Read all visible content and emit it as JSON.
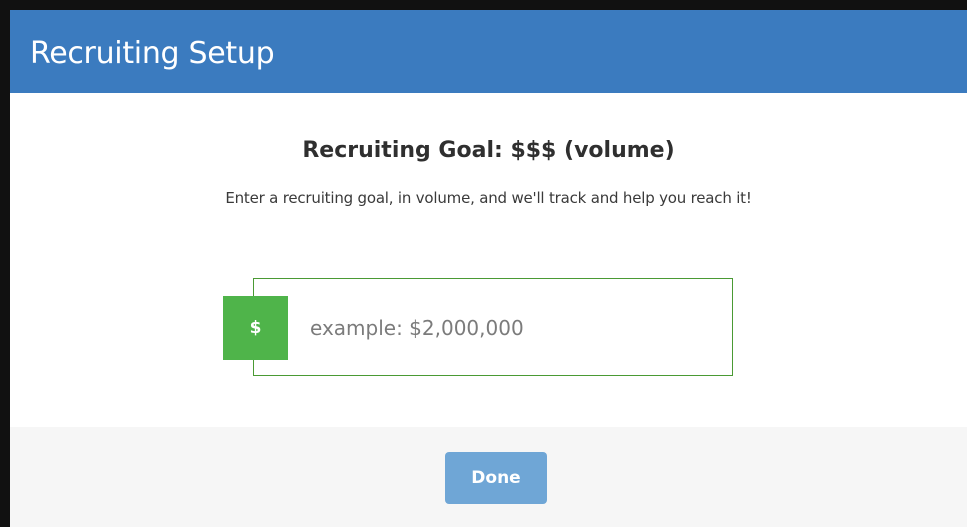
{
  "modal": {
    "title": "Recruiting Setup"
  },
  "goal": {
    "heading": "Recruiting Goal: $$$ (volume)",
    "description": "Enter a recruiting goal, in volume, and we'll track and help you reach it!",
    "currency_symbol": "$",
    "input_value": "",
    "input_placeholder": "example: $2,000,000"
  },
  "footer": {
    "done_label": "Done"
  },
  "colors": {
    "header_bg": "#3b7bbf",
    "badge_green": "#4fb44a",
    "input_border": "#4a9a34",
    "done_button_bg": "#6fa6d6",
    "footer_bg": "#f6f6f6"
  }
}
